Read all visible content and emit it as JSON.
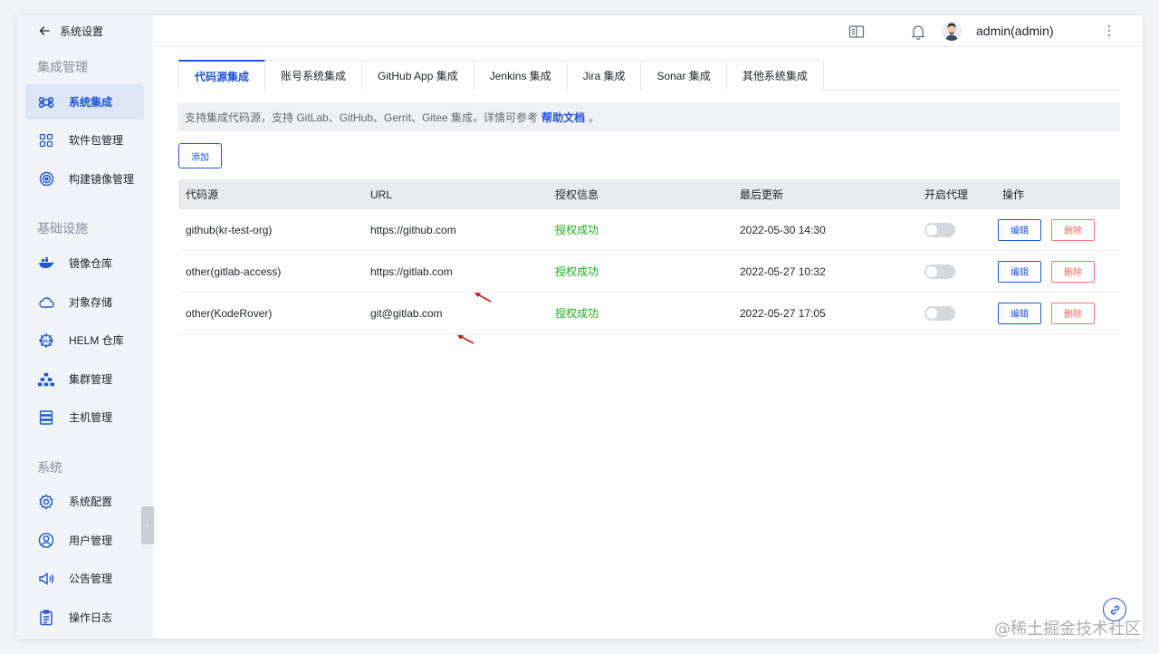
{
  "sidebar": {
    "back_label": "系统设置",
    "groups": [
      {
        "title": "集成管理",
        "items": [
          {
            "label": "系统集成",
            "icon": "integration-icon",
            "active": true
          },
          {
            "label": "软件包管理",
            "icon": "package-icon"
          },
          {
            "label": "构建镜像管理",
            "icon": "build-image-icon"
          }
        ]
      },
      {
        "title": "基础设施",
        "items": [
          {
            "label": "镜像仓库",
            "icon": "docker-registry-icon"
          },
          {
            "label": "对象存储",
            "icon": "cloud-storage-icon"
          },
          {
            "label": "HELM 仓库",
            "icon": "helm-icon"
          },
          {
            "label": "集群管理",
            "icon": "cluster-icon"
          },
          {
            "label": "主机管理",
            "icon": "server-icon"
          }
        ]
      },
      {
        "title": "系统",
        "items": [
          {
            "label": "系统配置",
            "icon": "settings-icon"
          },
          {
            "label": "用户管理",
            "icon": "user-icon"
          },
          {
            "label": "公告管理",
            "icon": "announcement-icon"
          },
          {
            "label": "操作日志",
            "icon": "log-icon"
          }
        ]
      }
    ]
  },
  "header": {
    "username": "admin(admin)",
    "icons": [
      "docs-icon",
      "bell-icon",
      "more-icon"
    ]
  },
  "tabs": [
    {
      "label": "代码源集成",
      "active": true
    },
    {
      "label": "账号系统集成"
    },
    {
      "label": "GitHub App 集成"
    },
    {
      "label": "Jenkins 集成"
    },
    {
      "label": "Jira 集成"
    },
    {
      "label": "Sonar 集成"
    },
    {
      "label": "其他系统集成"
    }
  ],
  "info": {
    "text": "支持集成代码源，支持 GitLab、GitHub、Gerrit、Gitee 集成，详情可参考",
    "link": "帮助文档",
    "tail": "。"
  },
  "add_button": "添加",
  "table": {
    "columns": [
      "代码源",
      "URL",
      "授权信息",
      "最后更新",
      "开启代理",
      "操作"
    ],
    "rows": [
      {
        "source": "github(kr-test-org)",
        "url": "https://github.com",
        "auth": "授权成功",
        "updated": "2022-05-30 14:30",
        "proxy": false
      },
      {
        "source": "other(gitlab-access)",
        "url": "https://gitlab.com",
        "auth": "授权成功",
        "updated": "2022-05-27 10:32",
        "proxy": false
      },
      {
        "source": "other(KodeRover)",
        "url": "git@gitlab.com",
        "auth": "授权成功",
        "updated": "2022-05-27 17:05",
        "proxy": false
      }
    ],
    "edit_label": "编辑",
    "delete_label": "删除"
  },
  "colors": {
    "accent": "#1f56d6",
    "success": "#19b11b",
    "danger": "#f06565"
  },
  "watermark": "@稀土掘金技术社区"
}
